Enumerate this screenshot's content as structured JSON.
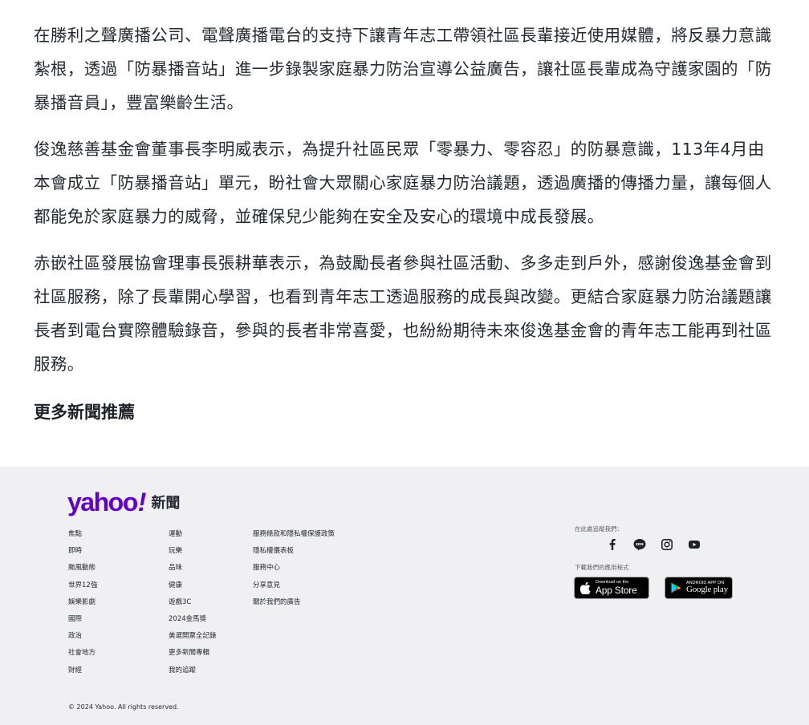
{
  "article": {
    "paragraphs": [
      "在勝利之聲廣播公司、電聲廣播電台的支持下讓青年志工帶領社區長輩接近使用媒體，將反暴力意識紮根，透過「防暴播音站」進一步錄製家庭暴力防治宣導公益廣告，讓社區長輩成為守護家園的「防暴播音員」，豐富樂齡生活。",
      "俊逸慈善基金會董事長李明威表示，為提升社區民眾「零暴力、零容忍」的防暴意識，113年4月由本會成立「防暴播音站」單元，盼社會大眾關心家庭暴力防治議題，透過廣播的傳播力量，讓每個人都能免於家庭暴力的威脅，並確保兒少能夠在安全及安心的環境中成長發展。",
      "赤嵌社區發展協會理事長張耕華表示，為鼓勵長者參與社區活動、多多走到戶外，感謝俊逸基金會到社區服務，除了長輩開心學習，也看到青年志工透過服務的成長與改變。更結合家庭暴力防治議題讓長者到電台實際體驗錄音，參與的長者非常喜愛，也紛紛期待未來俊逸基金會的青年志工能再到社區服務。"
    ],
    "more_news_title": "更多新聞推薦"
  },
  "footer": {
    "logo": {
      "word": "yahoo",
      "bang": "!",
      "section": "新聞",
      "color": "#6001d2"
    },
    "col1": [
      "焦點",
      "即時",
      "颱風動態",
      "世界12強",
      "娛樂影劇",
      "國際",
      "政治",
      "社會地方",
      "財經"
    ],
    "col2": [
      "運動",
      "玩樂",
      "品味",
      "健康",
      "遊戲3C",
      "2024金馬獎",
      "美選開票全記錄",
      "更多新聞專輯",
      "我的追蹤"
    ],
    "col3": [
      "服務條款和隱私權保護政策",
      "隱私權儀表板",
      "服務中心",
      "分享意見",
      "關於我們的廣告"
    ],
    "follow_label": "在此處追蹤我們：",
    "social_icons": [
      "facebook-icon",
      "line-icon",
      "instagram-icon",
      "youtube-icon"
    ],
    "download_label": "下載我們的應用程式",
    "appstore": {
      "small": "Download on the",
      "big": "App Store"
    },
    "googleplay": {
      "small": "ANDROID APP ON",
      "big": "Google play"
    },
    "copyright": "© 2024 Yahoo. All rights reserved."
  }
}
